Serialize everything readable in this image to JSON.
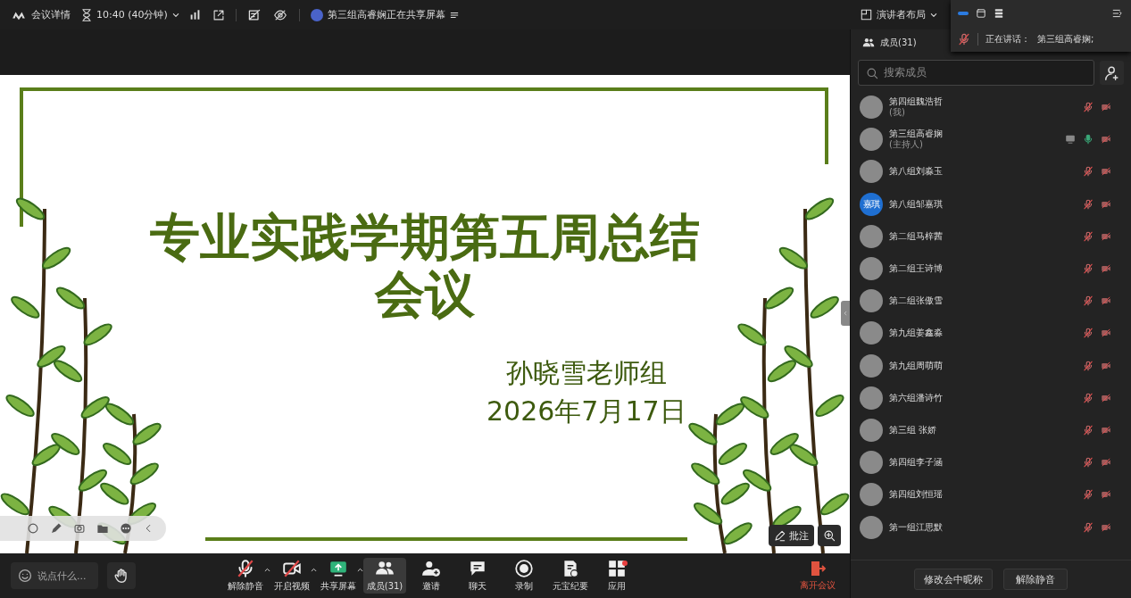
{
  "top_bar": {
    "meeting_info": "会议详情",
    "time": "10:40 (40分钟)",
    "sharing_notice": "第三组高睿娴正在共享屏幕",
    "layout": "演讲者布局"
  },
  "speaking_widget": {
    "label": "正在讲话：",
    "speaker": "第三组高睿娴;"
  },
  "slide": {
    "title": "专业实践学期第五周总结会议",
    "author": "孙晓雪老师组",
    "date": "2026年7月17日"
  },
  "annotate_button": "批注",
  "members": {
    "title": "成员(31)",
    "search_placeholder": "搜索成员",
    "list": [
      {
        "name": "第四组魏浩哲",
        "role": "(我)",
        "muted": true,
        "sharing": false
      },
      {
        "name": "第三组高睿娴",
        "role": "(主持人)",
        "muted": false,
        "sharing": true
      },
      {
        "name": "第八组刘淼玉",
        "muted": true,
        "sharing": false
      },
      {
        "name": "第八组邹嘉琪",
        "avatar_text": "嘉琪",
        "muted": true,
        "sharing": false
      },
      {
        "name": "第二组马梓茜",
        "muted": true,
        "sharing": false
      },
      {
        "name": "第二组王诗博",
        "muted": true,
        "sharing": false
      },
      {
        "name": "第二组张傲雪",
        "muted": true,
        "sharing": false
      },
      {
        "name": "第九组姜鑫淼",
        "muted": true,
        "sharing": false
      },
      {
        "name": "第九组周萌萌",
        "muted": true,
        "sharing": false
      },
      {
        "name": "第六组潘诗竹",
        "muted": true,
        "sharing": false
      },
      {
        "name": "第三组 张娇",
        "muted": true,
        "sharing": false
      },
      {
        "name": "第四组李子涵",
        "muted": true,
        "sharing": false
      },
      {
        "name": "第四组刘恒瑶",
        "muted": true,
        "sharing": false
      },
      {
        "name": "第一组江思默",
        "muted": true,
        "sharing": false
      }
    ],
    "buttons": [
      "修改会中昵称",
      "解除静音"
    ]
  },
  "toolbar": {
    "chat_placeholder": "说点什么...",
    "tools": [
      {
        "kind": "mic",
        "label": "解除静音",
        "menu": true,
        "selected": false
      },
      {
        "kind": "video",
        "label": "开启视频",
        "menu": true,
        "selected": false
      },
      {
        "kind": "share",
        "label": "共享屏幕",
        "menu": true,
        "selected": false
      },
      {
        "kind": "members",
        "label": "成员(31)",
        "menu": false,
        "selected": true
      },
      {
        "kind": "invite",
        "label": "邀请",
        "menu": false,
        "selected": false
      },
      {
        "kind": "chat",
        "label": "聊天",
        "menu": false,
        "selected": false
      },
      {
        "kind": "record",
        "label": "录制",
        "menu": false,
        "selected": false
      },
      {
        "kind": "notes",
        "label": "元宝纪要",
        "menu": false,
        "selected": false
      },
      {
        "kind": "apps",
        "label": "应用",
        "menu": false,
        "selected": false,
        "badge": true
      }
    ],
    "leave": "离开会议"
  }
}
